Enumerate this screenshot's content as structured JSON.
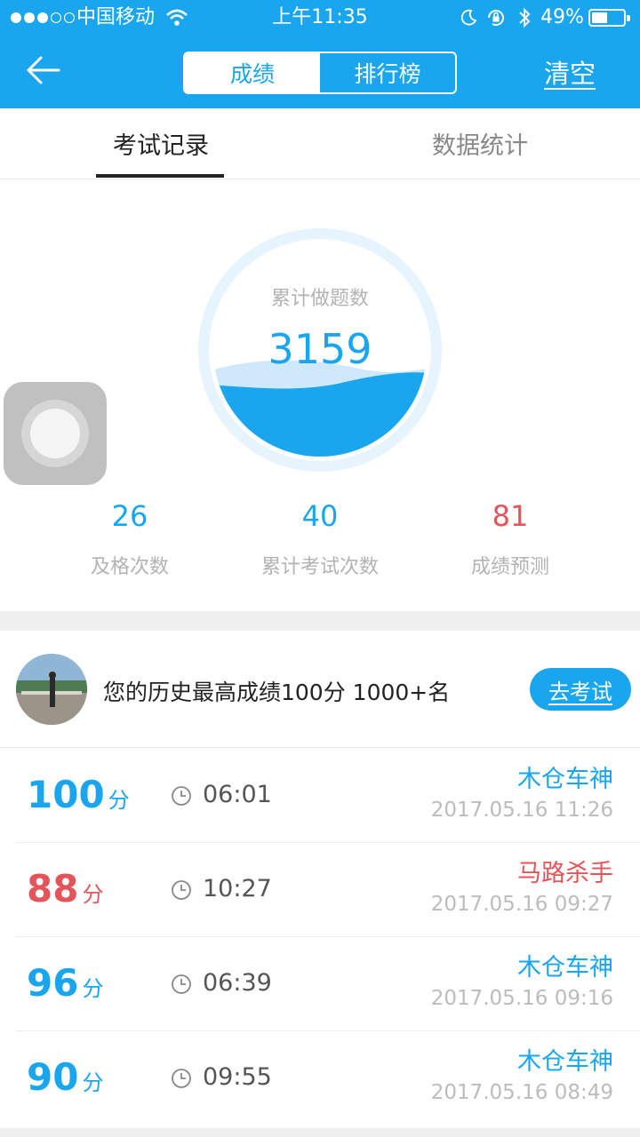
{
  "status_bar": {
    "carrier": "中国移动",
    "time": "上午11:35",
    "battery": "49%",
    "battery_level": 0.49,
    "signal_dots_filled": 3,
    "signal_dots_total": 5,
    "icons": [
      "wifi-icon",
      "moon-icon",
      "rotation-lock-icon",
      "bluetooth-icon",
      "battery-icon"
    ]
  },
  "nav": {
    "back_icon": "arrow-left-icon",
    "segments": [
      "成绩",
      "排行榜"
    ],
    "selected_segment": 0,
    "clear_label": "清空"
  },
  "tabs": {
    "items": [
      "考试记录",
      "数据统计"
    ],
    "selected": 0
  },
  "summary": {
    "circle_label": "累计做题数",
    "circle_value": "3159",
    "stats": [
      {
        "value": "26",
        "label": "及格次数",
        "color": "#1aa6ee"
      },
      {
        "value": "40",
        "label": "累计考试次数",
        "color": "#1aa6ee"
      },
      {
        "value": "81",
        "label": "成绩预测",
        "color": "#e5545a"
      }
    ]
  },
  "best": {
    "text": "您的历史最高成绩100分 1000+名",
    "button": "去考试"
  },
  "records": [
    {
      "score": "100",
      "unit": "分",
      "duration": "06:01",
      "title": "木仓车神",
      "date": "2017.05.16 11:26",
      "color": "#1aa6ee"
    },
    {
      "score": "88",
      "unit": "分",
      "duration": "10:27",
      "title": "马路杀手",
      "date": "2017.05.16 09:27",
      "color": "#e5545a"
    },
    {
      "score": "96",
      "unit": "分",
      "duration": "06:39",
      "title": "木仓车神",
      "date": "2017.05.16 09:16",
      "color": "#1aa6ee"
    },
    {
      "score": "90",
      "unit": "分",
      "duration": "09:55",
      "title": "木仓车神",
      "date": "2017.05.16 08:49",
      "color": "#1aa6ee"
    }
  ],
  "colors": {
    "accent": "#1aa6ee",
    "warning": "#e5545a",
    "muted": "#b3b3b3"
  }
}
